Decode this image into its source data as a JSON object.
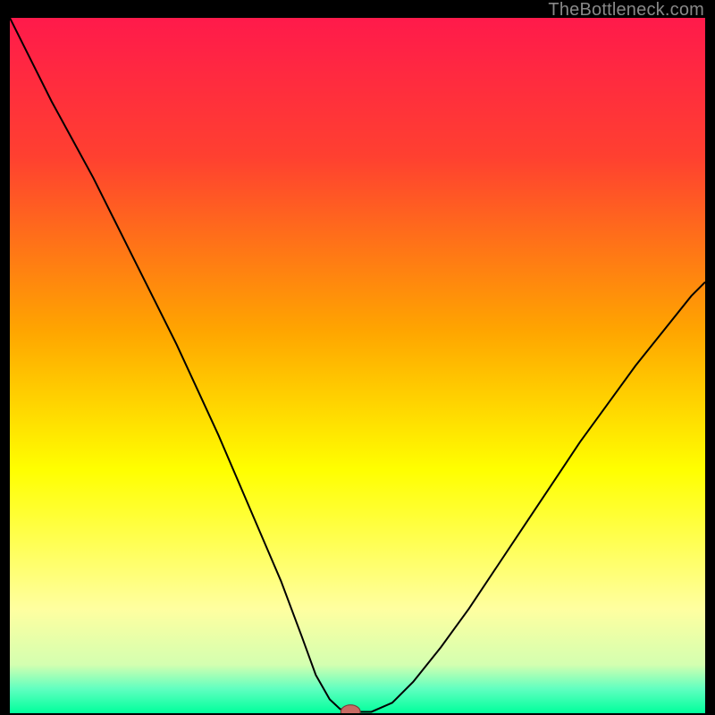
{
  "watermark": "TheBottleneck.com",
  "chart_data": {
    "type": "line",
    "title": "",
    "xlabel": "",
    "ylabel": "",
    "xlim": [
      0,
      100
    ],
    "ylim": [
      0,
      100
    ],
    "grid": false,
    "background_gradient": {
      "stops": [
        {
          "offset": 0.0,
          "color": "#ff1a4b"
        },
        {
          "offset": 0.2,
          "color": "#ff4030"
        },
        {
          "offset": 0.45,
          "color": "#ffa500"
        },
        {
          "offset": 0.65,
          "color": "#ffff00"
        },
        {
          "offset": 0.85,
          "color": "#ffffa0"
        },
        {
          "offset": 0.93,
          "color": "#d4ffb0"
        },
        {
          "offset": 0.965,
          "color": "#60ffc0"
        },
        {
          "offset": 1.0,
          "color": "#00ff9c"
        }
      ]
    },
    "curve_comment": "V-shaped bottleneck curve: high mismatch (near 100) at the extremes, dipping to ~0 near x≈49 where the red marker sits.",
    "series": [
      {
        "name": "bottleneck-curve",
        "color": "#000000",
        "width": 2,
        "x": [
          0.0,
          3,
          6,
          9,
          12,
          15,
          18,
          21,
          24,
          27,
          30,
          33,
          36,
          39,
          42,
          44,
          46,
          47.5,
          49,
          52,
          55,
          58,
          62,
          66,
          70,
          74,
          78,
          82,
          86,
          90,
          94,
          98,
          100
        ],
        "y": [
          100,
          94,
          88,
          82.5,
          77,
          71,
          65,
          59,
          53,
          46.5,
          40,
          33,
          26,
          19,
          11,
          5.5,
          2.0,
          0.6,
          0.2,
          0.2,
          1.5,
          4.5,
          9.5,
          15,
          21,
          27,
          33,
          39,
          44.5,
          50,
          55,
          60,
          62
        ]
      }
    ],
    "marker": {
      "name": "optimal-point",
      "x": 49,
      "y": 0.2,
      "rx": 1.4,
      "ry": 1.0,
      "fill": "#c96a63",
      "stroke": "#7a3c38"
    }
  }
}
